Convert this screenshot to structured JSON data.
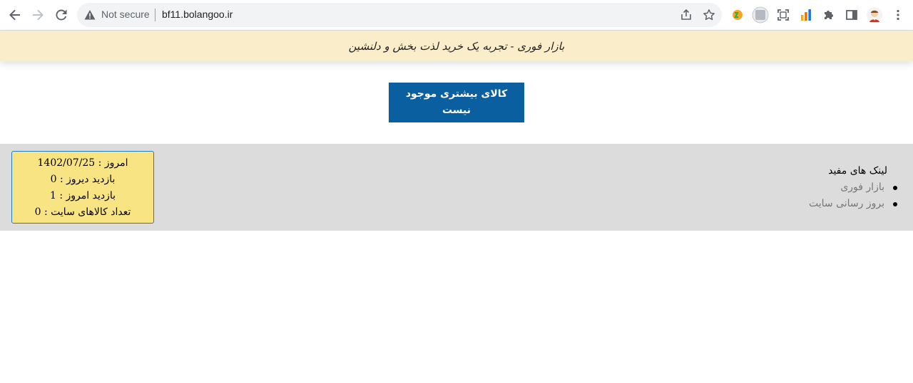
{
  "browser": {
    "security_label": "Not secure",
    "url": "bf11.bolangoo.ir"
  },
  "page": {
    "banner_text": "بازار فوری - تجربه یک خرید لذت بخش و دلنشین",
    "notice_text": "کالای بیشتری موجود نیست"
  },
  "stats": {
    "today": "امروز : 1402/07/25",
    "yesterday_visits": "بازدید دیروز : 0",
    "today_visits": "بازدید امروز : 1",
    "product_count": "تعداد کالاهای سایت : 0"
  },
  "links": {
    "title": "لینک های مفید",
    "items": [
      "بازار فوری",
      "بروز رسانی سایت"
    ]
  },
  "colors": {
    "banner_bg": "#faedca",
    "notice_bg": "#0a5fa0",
    "footer_bg": "#dcdcdc",
    "stats_bg": "#f9e483"
  }
}
